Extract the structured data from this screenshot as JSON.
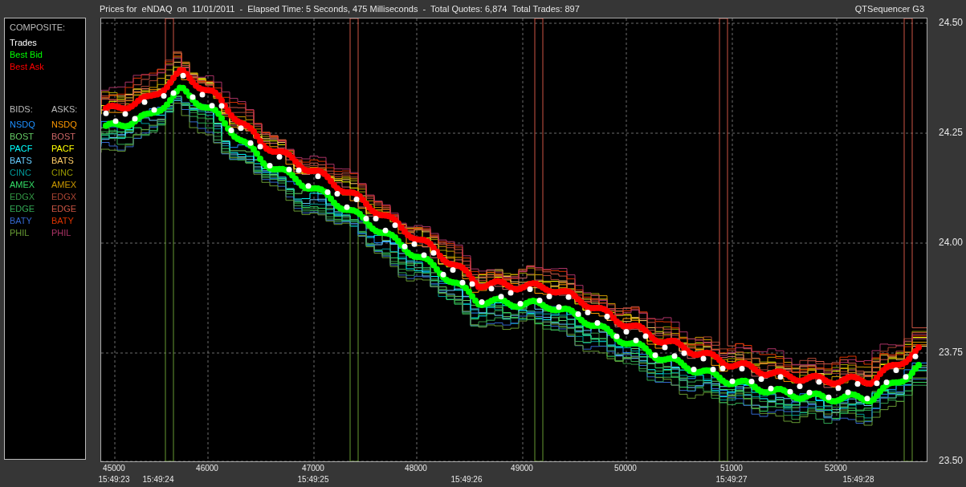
{
  "title_bar": {
    "text": "Prices for  eNDAQ  on  11/01/2011  -  Elapsed Time: 5 Seconds, 475 Milliseconds  -  Total Quotes: 6,874  Total Trades: 897",
    "app_name": "QTSequencer G3"
  },
  "legend": {
    "composite_heading": "COMPOSITE:",
    "composite": [
      {
        "label": "Trades",
        "color": "#ffffff"
      },
      {
        "label": "Best Bid",
        "color": "#00ff00"
      },
      {
        "label": "Best Ask",
        "color": "#ff0000"
      }
    ],
    "bids_heading": "BIDS:",
    "asks_heading": "ASKS:",
    "bids": [
      {
        "label": "NSDQ",
        "color": "#1e90ff"
      },
      {
        "label": "BOST",
        "color": "#66cc66"
      },
      {
        "label": "PACF",
        "color": "#00ffff"
      },
      {
        "label": "BATS",
        "color": "#66ccff"
      },
      {
        "label": "CINC",
        "color": "#009999"
      },
      {
        "label": "AMEX",
        "color": "#33dd66"
      },
      {
        "label": "EDGX",
        "color": "#339944"
      },
      {
        "label": "EDGE",
        "color": "#33aa55"
      },
      {
        "label": "BATY",
        "color": "#3366cc"
      },
      {
        "label": "PHIL",
        "color": "#669933"
      }
    ],
    "asks": [
      {
        "label": "NSDQ",
        "color": "#ff9900"
      },
      {
        "label": "BOST",
        "color": "#cc6666"
      },
      {
        "label": "PACF",
        "color": "#ffff00"
      },
      {
        "label": "BATS",
        "color": "#ffcc66"
      },
      {
        "label": "CINC",
        "color": "#999900"
      },
      {
        "label": "AMEX",
        "color": "#cc9900"
      },
      {
        "label": "EDGX",
        "color": "#aa4433"
      },
      {
        "label": "EDGE",
        "color": "#cc5544"
      },
      {
        "label": "BATY",
        "color": "#dd3300"
      },
      {
        "label": "PHIL",
        "color": "#aa3366"
      }
    ]
  },
  "chart": {
    "y_labels": [
      "24.50",
      "24.25",
      "24.00",
      "23.75",
      "23.50"
    ],
    "x_labels": [
      "45000",
      "46000",
      "47000",
      "48000",
      "49000",
      "50000",
      "51000",
      "52000"
    ],
    "time_labels": [
      "15:49:23",
      "15:49:24",
      "15:49:25",
      "15:49:26",
      "15:49:27",
      "15:49:28"
    ]
  }
}
